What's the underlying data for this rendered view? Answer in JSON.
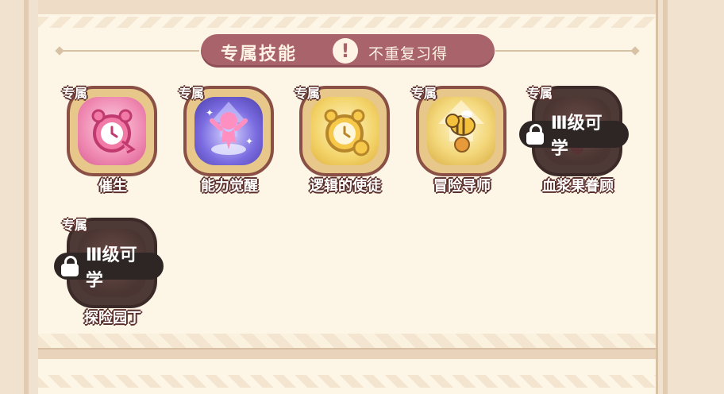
{
  "header": {
    "title": "专属技能",
    "note": "不重复习得"
  },
  "skills": [
    {
      "tag": "专属",
      "name": "催生",
      "icon": "alarm-clock-pink-icon",
      "locked": false
    },
    {
      "tag": "专属",
      "name": "能力觉醒",
      "icon": "awakening-figure-icon",
      "locked": false
    },
    {
      "tag": "专属",
      "name": "逻辑的使徒",
      "icon": "alarm-clock-gold-icon",
      "locked": false
    },
    {
      "tag": "专属",
      "name": "冒险导师",
      "icon": "bee-mentor-icon",
      "locked": false
    },
    {
      "tag": "专属",
      "name": "血浆果眷顾",
      "icon": "blood-berry-icon",
      "locked": true,
      "lock_text": "Ⅲ级可学"
    },
    {
      "tag": "专属",
      "name": "探险园丁",
      "icon": "gardener-icon",
      "locked": true,
      "lock_text": "Ⅲ级可学"
    }
  ],
  "colors": {
    "header_bg": "#a9646b",
    "panel_bg": "#fdf5e6",
    "badge_border": "#8a4f45",
    "lock_bg": "#2d2624"
  }
}
